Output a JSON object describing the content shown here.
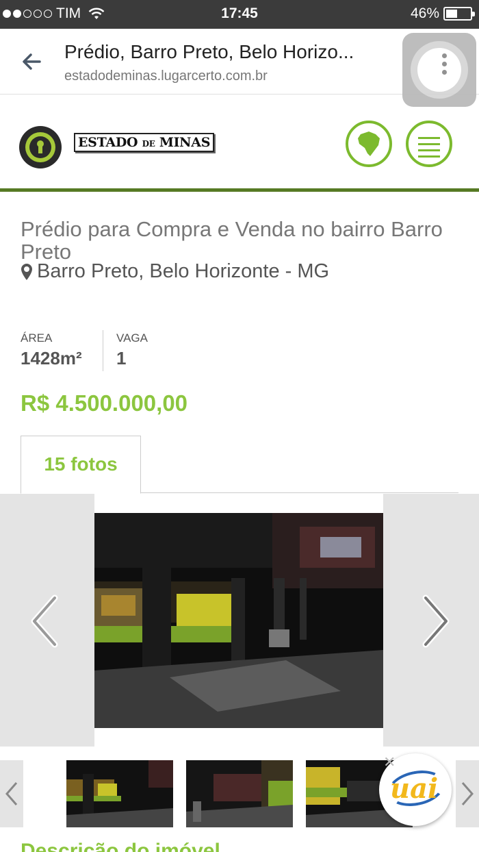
{
  "status_bar": {
    "carrier": "TIM",
    "time": "17:45",
    "battery": "46%",
    "battery_level": 0.46
  },
  "browser": {
    "title": "Prédio, Barro Preto, Belo Horizo...",
    "url": "estadodeminas.lugarcerto.com.br"
  },
  "site": {
    "brand_main": "ESTADO ",
    "brand_small": "DE",
    "brand_end": " MINAS"
  },
  "listing": {
    "title": "Prédio para Compra e Venda no bairro Barro Preto",
    "location": "Barro Preto, Belo Horizonte - MG",
    "area_label": "ÁREA",
    "area_value": "1428m²",
    "vaga_label": "VAGA",
    "vaga_value": "1",
    "price": "R$ 4.500.000,00"
  },
  "gallery": {
    "tab_label": "15 fotos"
  },
  "section": {
    "description_heading": "Descrição do imóvel"
  },
  "badge": {
    "text": "uai",
    "close": "✕"
  },
  "colors": {
    "accent_green": "#8cc63f",
    "header_rule": "#567a24",
    "status_bar_bg": "#3b3b3b"
  },
  "icons": [
    "back-arrow-icon",
    "kebab-menu-icon",
    "brazil-map-icon",
    "hamburger-menu-icon",
    "location-pin-icon",
    "chevron-left-icon",
    "chevron-right-icon",
    "wifi-icon",
    "battery-icon"
  ]
}
